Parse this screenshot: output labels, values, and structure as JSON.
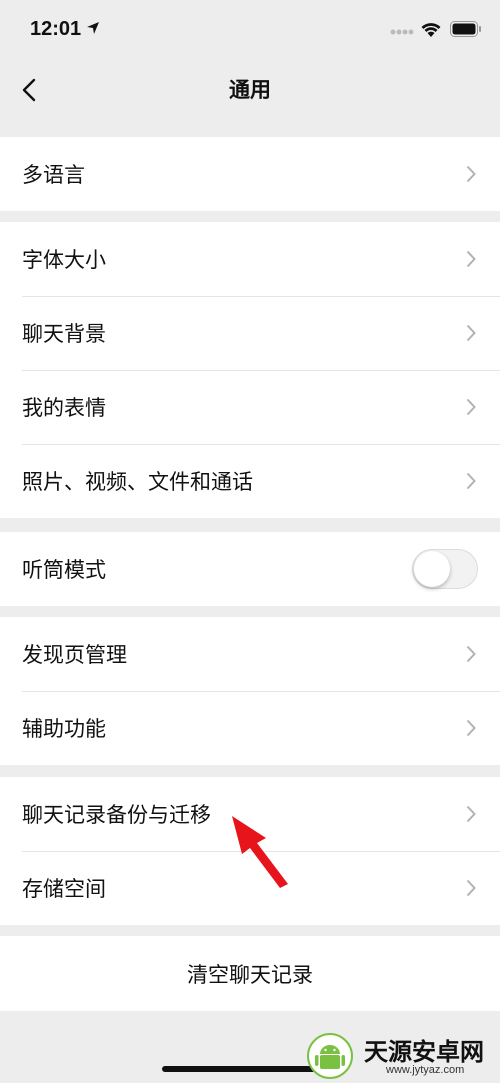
{
  "status_bar": {
    "time": "12:01"
  },
  "nav": {
    "title": "通用",
    "back_icon": "chevron-left-icon"
  },
  "groups": [
    {
      "items": [
        {
          "label": "多语言"
        }
      ]
    },
    {
      "items": [
        {
          "label": "字体大小"
        },
        {
          "label": "聊天背景"
        },
        {
          "label": "我的表情"
        },
        {
          "label": "照片、视频、文件和通话"
        }
      ]
    },
    {
      "items": [
        {
          "label": "听筒模式",
          "toggle_on": false
        }
      ]
    },
    {
      "items": [
        {
          "label": "发现页管理"
        },
        {
          "label": "辅助功能"
        }
      ]
    },
    {
      "items": [
        {
          "label": "聊天记录备份与迁移"
        },
        {
          "label": "存储空间"
        }
      ]
    }
  ],
  "clear_button": {
    "label": "清空聊天记录"
  },
  "watermark": {
    "name": "天源安卓网",
    "url": "www.jytyaz.com"
  },
  "colors": {
    "background": "#ededed",
    "cell": "#ffffff",
    "annotation_arrow": "#e8141c",
    "watermark_green": "#7ac142"
  }
}
